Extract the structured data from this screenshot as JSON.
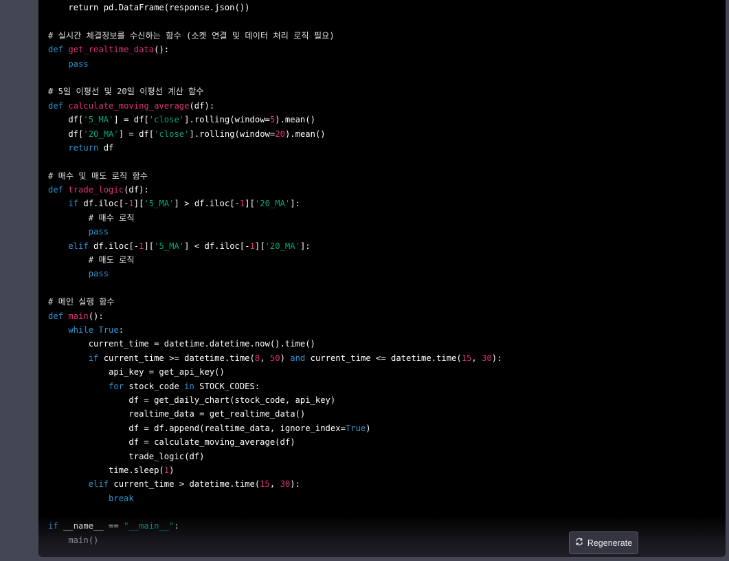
{
  "code": {
    "lines": [
      [
        [
          "id",
          "    return pd.DataFrame(response.json())"
        ]
      ],
      [],
      [
        [
          "cm",
          "# 실시간 체결정보를 수신하는 함수 (소켓 연결 및 데이터 처리 로직 필요)"
        ]
      ],
      [
        [
          "kw",
          "def "
        ],
        [
          "fn",
          "get_realtime_data"
        ],
        [
          "id",
          "():"
        ]
      ],
      [
        [
          "kw",
          "    pass"
        ]
      ],
      [],
      [
        [
          "cm",
          "# 5일 이평선 및 20일 이평선 계산 함수"
        ]
      ],
      [
        [
          "kw",
          "def "
        ],
        [
          "fn",
          "calculate_moving_average"
        ],
        [
          "id",
          "(df):"
        ]
      ],
      [
        [
          "id",
          "    df["
        ],
        [
          "str",
          "'5_MA'"
        ],
        [
          "id",
          "] = df["
        ],
        [
          "str",
          "'close'"
        ],
        [
          "id",
          "].rolling(window="
        ],
        [
          "num",
          "5"
        ],
        [
          "id",
          ").mean()"
        ]
      ],
      [
        [
          "id",
          "    df["
        ],
        [
          "str",
          "'20_MA'"
        ],
        [
          "id",
          "] = df["
        ],
        [
          "str",
          "'close'"
        ],
        [
          "id",
          "].rolling(window="
        ],
        [
          "num",
          "20"
        ],
        [
          "id",
          ").mean()"
        ]
      ],
      [
        [
          "kw",
          "    return "
        ],
        [
          "id",
          "df"
        ]
      ],
      [],
      [
        [
          "cm",
          "# 매수 및 매도 로직 함수"
        ]
      ],
      [
        [
          "kw",
          "def "
        ],
        [
          "fn",
          "trade_logic"
        ],
        [
          "id",
          "(df):"
        ]
      ],
      [
        [
          "kw",
          "    if "
        ],
        [
          "id",
          "df.iloc[-"
        ],
        [
          "num",
          "1"
        ],
        [
          "id",
          "]["
        ],
        [
          "str",
          "'5_MA'"
        ],
        [
          "id",
          "] > df.iloc[-"
        ],
        [
          "num",
          "1"
        ],
        [
          "id",
          "]["
        ],
        [
          "str",
          "'20_MA'"
        ],
        [
          "id",
          "]:"
        ]
      ],
      [
        [
          "cm",
          "        # 매수 로직"
        ]
      ],
      [
        [
          "kw",
          "        pass"
        ]
      ],
      [
        [
          "kw",
          "    elif "
        ],
        [
          "id",
          "df.iloc[-"
        ],
        [
          "num",
          "1"
        ],
        [
          "id",
          "]["
        ],
        [
          "str",
          "'5_MA'"
        ],
        [
          "id",
          "] < df.iloc[-"
        ],
        [
          "num",
          "1"
        ],
        [
          "id",
          "]["
        ],
        [
          "str",
          "'20_MA'"
        ],
        [
          "id",
          "]:"
        ]
      ],
      [
        [
          "cm",
          "        # 매도 로직"
        ]
      ],
      [
        [
          "kw",
          "        pass"
        ]
      ],
      [],
      [
        [
          "cm",
          "# 메인 실행 함수"
        ]
      ],
      [
        [
          "kw",
          "def "
        ],
        [
          "fn",
          "main"
        ],
        [
          "id",
          "():"
        ]
      ],
      [
        [
          "kw",
          "    while "
        ],
        [
          "kw",
          "True"
        ],
        [
          "id",
          ":"
        ]
      ],
      [
        [
          "id",
          "        current_time = datetime.datetime.now().time()"
        ]
      ],
      [
        [
          "kw",
          "        if "
        ],
        [
          "id",
          "current_time >= datetime.time("
        ],
        [
          "num",
          "8"
        ],
        [
          "id",
          ", "
        ],
        [
          "num",
          "50"
        ],
        [
          "id",
          ") "
        ],
        [
          "kw",
          "and "
        ],
        [
          "id",
          "current_time <= datetime.time("
        ],
        [
          "num",
          "15"
        ],
        [
          "id",
          ", "
        ],
        [
          "num",
          "30"
        ],
        [
          "id",
          "):"
        ]
      ],
      [
        [
          "id",
          "            api_key = get_api_key()"
        ]
      ],
      [
        [
          "kw",
          "            for "
        ],
        [
          "id",
          "stock_code "
        ],
        [
          "kw",
          "in "
        ],
        [
          "id",
          "STOCK_CODES:"
        ]
      ],
      [
        [
          "id",
          "                df = get_daily_chart(stock_code, api_key)"
        ]
      ],
      [
        [
          "id",
          "                realtime_data = get_realtime_data()"
        ]
      ],
      [
        [
          "id",
          "                df = df.append(realtime_data, ignore_index="
        ],
        [
          "kw",
          "True"
        ],
        [
          "id",
          ")"
        ]
      ],
      [
        [
          "id",
          "                df = calculate_moving_average(df)"
        ]
      ],
      [
        [
          "id",
          "                trade_logic(df)"
        ]
      ],
      [
        [
          "id",
          "            time.sleep("
        ],
        [
          "num",
          "1"
        ],
        [
          "id",
          ")"
        ]
      ],
      [
        [
          "kw",
          "        elif "
        ],
        [
          "id",
          "current_time > datetime.time("
        ],
        [
          "num",
          "15"
        ],
        [
          "id",
          ", "
        ],
        [
          "num",
          "30"
        ],
        [
          "id",
          "):"
        ]
      ],
      [
        [
          "kw",
          "            break"
        ]
      ],
      [],
      [
        [
          "kw",
          "if "
        ],
        [
          "id",
          "__name__ == "
        ],
        [
          "str",
          "\"__main__\""
        ],
        [
          "id",
          ":"
        ]
      ],
      [
        [
          "id",
          "    main()"
        ]
      ]
    ]
  },
  "regenerate": {
    "label": "Regenerate",
    "icon": "refresh-icon"
  }
}
